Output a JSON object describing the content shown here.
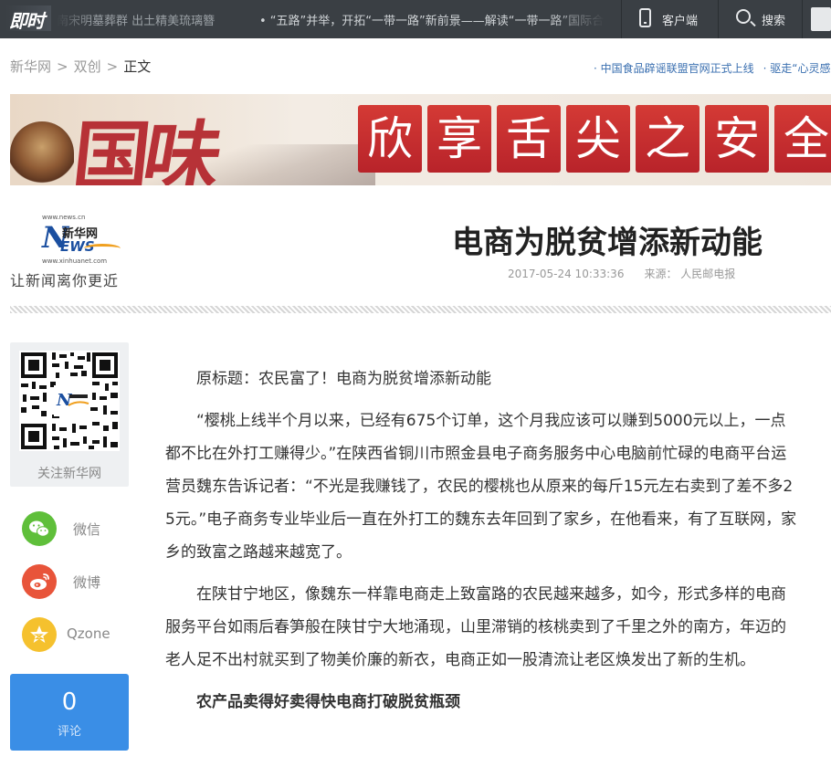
{
  "topbar": {
    "logo": "即时",
    "ticker": [
      "南宋明墓葬群 出土精美琉璃簪",
      "• “五路”并举，开拓“一带一路”新前景——解读“一带一路”国际合作"
    ],
    "client_label": "客户端",
    "search_label": "搜索"
  },
  "breadcrumb": {
    "items": [
      "新华网",
      "双创"
    ],
    "current": "正文",
    "separator": ">"
  },
  "news_links": [
    "· 中国食品辟谣联盟官网正式上线",
    "· 驱走“心灵感冒”"
  ],
  "banner": {
    "left_chars": [
      "国",
      "味"
    ],
    "slogan_chars": [
      "欣",
      "享",
      "舌",
      "尖",
      "之",
      "安",
      "全"
    ]
  },
  "site_logo": {
    "url_top": "www.news.cn",
    "letter_n": "N",
    "letters_ews": "EWS",
    "name": "新华网",
    "url_bottom": "www.xinhuanet.com",
    "slogan": "让新闻离你更近"
  },
  "article_header": {
    "title": "电商为脱贫增添新动能",
    "datetime": "2017-05-24 10:33:36",
    "source": "来源： 人民邮电报"
  },
  "sidebar": {
    "qr_label": "关注新华网",
    "share": {
      "wechat": "微信",
      "weibo": "微博",
      "qzone": "Qzone"
    },
    "comment": {
      "count": "0",
      "label": "评论"
    }
  },
  "article": {
    "paragraphs": [
      "原标题：农民富了！电商为脱贫增添新动能",
      "“樱桃上线半个月以来，已经有675个订单，这个月我应该可以赚到5000元以上，一点都不比在外打工赚得少。”在陕西省铜川市照金县电子商务服务中心电脑前忙碌的电商平台运营员魏东告诉记者：“不光是我赚钱了，农民的樱桃也从原来的每斤15元左右卖到了差不多25元。”电子商务专业毕业后一直在外打工的魏东去年回到了家乡，在他看来，有了互联网，家乡的致富之路越来越宽了。",
      "在陕甘宁地区，像魏东一样靠电商走上致富路的农民越来越多，如今，形式多样的电商服务平台如雨后春笋般在陕甘宁大地涌现，山里滞销的核桃卖到了千里之外的南方，年迈的老人足不出村就买到了物美价廉的新衣，电商正如一股清流让老区焕发出了新的生机。"
    ],
    "subheading": "农产品卖得好卖得快电商打破脱贫瓶颈"
  },
  "colors": {
    "topbar_bg": "#3a3f44",
    "wechat": "#5fbf3a",
    "weibo": "#e8543a",
    "qzone": "#f5c12e",
    "comment_bg": "#3a8ee6",
    "banner_red": "#c52a2e"
  },
  "icons": {
    "client": "phone-icon",
    "search": "search-icon",
    "menu": "menu-icon",
    "wechat": "wechat-icon",
    "weibo": "weibo-icon",
    "qzone": "qzone-star-icon",
    "qr": "qr-code"
  }
}
